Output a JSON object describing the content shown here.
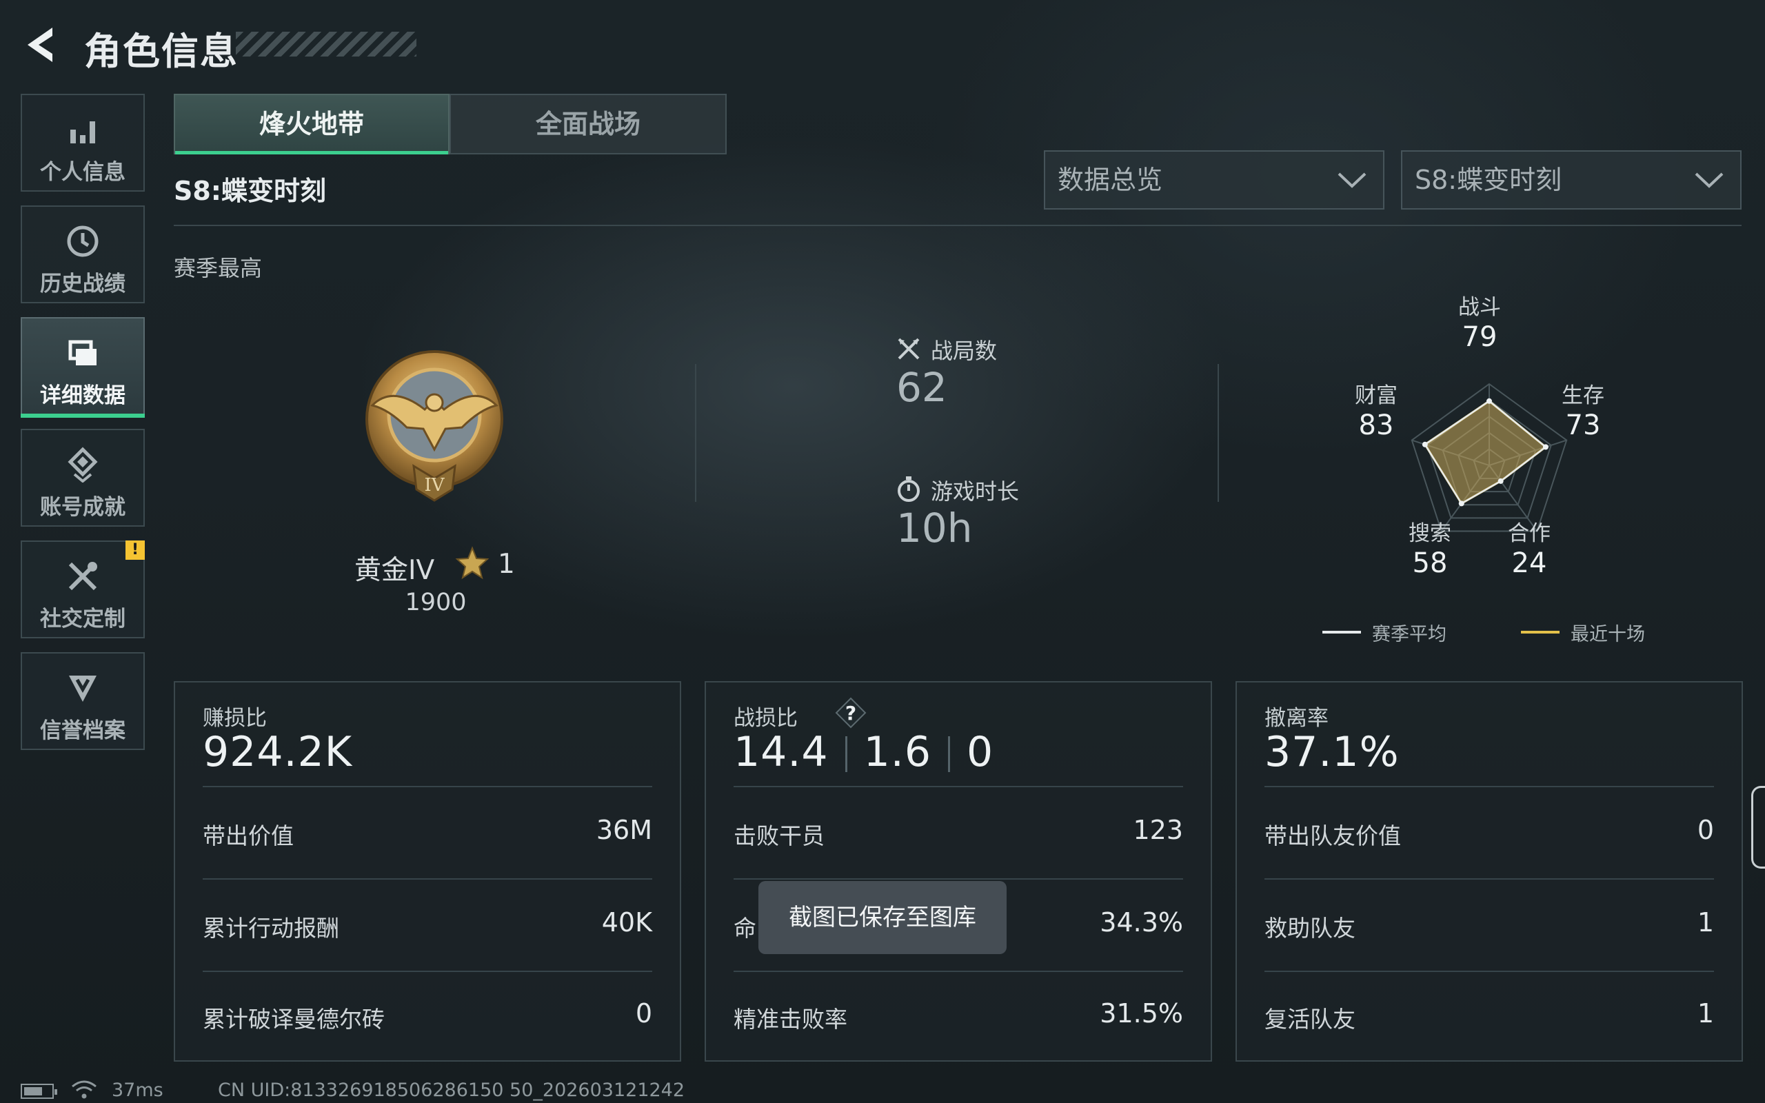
{
  "header": {
    "title": "角色信息"
  },
  "sidebar": {
    "items": [
      {
        "label": "个人信息",
        "icon": "bar-chart-icon"
      },
      {
        "label": "历史战绩",
        "icon": "history-clock-icon"
      },
      {
        "label": "详细数据",
        "icon": "folder-icon",
        "active": true
      },
      {
        "label": "账号成就",
        "icon": "achievement-icon"
      },
      {
        "label": "社交定制",
        "icon": "tools-icon",
        "badge": "!"
      },
      {
        "label": "信誉档案",
        "icon": "shield-chevron-icon"
      }
    ]
  },
  "tabs": [
    {
      "label": "烽火地带",
      "active": true
    },
    {
      "label": "全面战场",
      "active": false
    }
  ],
  "season": "S8:蝶变时刻",
  "filters": {
    "data_type": "数据总览",
    "season": "S8:蝶变时刻"
  },
  "section_label": "赛季最高",
  "rank": {
    "name": "黄金IV",
    "stars": "1",
    "score": "1900",
    "medal_numeral": "IV"
  },
  "stats": {
    "matches": {
      "label": "战局数",
      "value": "62"
    },
    "playtime": {
      "label": "游戏时长",
      "value": "10h"
    }
  },
  "radar": {
    "labels": {
      "combat": "战斗",
      "survival": "生存",
      "cooperation": "合作",
      "search": "搜索",
      "wealth": "财富"
    },
    "values": {
      "combat": 79,
      "survival": 73,
      "cooperation": 24,
      "search": 58,
      "wealth": 83
    },
    "legend": {
      "season_avg": "赛季平均",
      "recent_ten": "最近十场"
    },
    "colors": {
      "season_avg": "#e6eaec",
      "recent_ten": "#e3c04a"
    }
  },
  "cards": {
    "profit": {
      "title": "赚损比",
      "value": "924.2K",
      "rows": [
        {
          "label": "带出价值",
          "value": "36M"
        },
        {
          "label": "累计行动报酬",
          "value": "40K"
        },
        {
          "label": "累计破译曼德尔砖",
          "value": "0"
        }
      ]
    },
    "combat": {
      "title": "战损比",
      "values": [
        "14.4",
        "1.6",
        "0"
      ],
      "rows": [
        {
          "label": "击败干员",
          "value": "123"
        },
        {
          "label": "命",
          "value": "34.3%"
        },
        {
          "label": "精准击败率",
          "value": "31.5%"
        }
      ]
    },
    "extract": {
      "title": "撤离率",
      "value": "37.1%",
      "rows": [
        {
          "label": "带出队友价值",
          "value": "0"
        },
        {
          "label": "救助队友",
          "value": "1"
        },
        {
          "label": "复活队友",
          "value": "1"
        }
      ]
    }
  },
  "toast": "截图已保存至图库",
  "status_bar": {
    "latency": "37ms",
    "uid": "CN UID:813326918506286150 50_202603121242"
  }
}
